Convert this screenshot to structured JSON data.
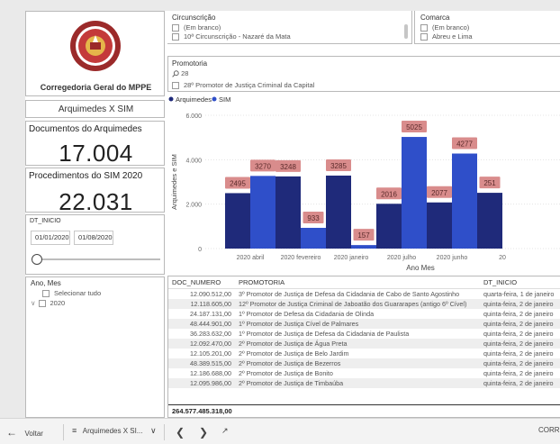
{
  "header": {
    "org_title": "Corregedoria Geral do MPPE",
    "report_title": "Arquimedes X SIM"
  },
  "kpis": {
    "docs_label": "Documentos do Arquimedes",
    "docs_value": "17.004",
    "proc_label": "Procedimentos do SIM 2020",
    "proc_value": "22.031"
  },
  "date_filter": {
    "label": "DT_INICIO",
    "start": "01/01/2020",
    "end": "01/08/2020",
    "slider_position": 0.0
  },
  "ano_mes": {
    "label": "Ano, Mes",
    "select_all": "Selecionar tudo",
    "year": "2020"
  },
  "circunscricao": {
    "label": "Circunscrição",
    "items": [
      "(Em branco)",
      "10ª Circunscrição - Nazaré da Mata"
    ]
  },
  "comarca": {
    "label": "Comarca",
    "items": [
      "(Em branco)",
      "Abreu e Lima"
    ]
  },
  "promotoria": {
    "label": "Promotoria",
    "search_value": "28",
    "item": "28º Promotor de Justiça Criminal da Capital"
  },
  "colors": {
    "arquimedes": "#1f2a7a",
    "sim": "#2f4fc9",
    "data_label_bg": "#d98c8c",
    "kpi_border": "#b0b0b0"
  },
  "chart_data": {
    "type": "bar",
    "legend": [
      "Arquimedes",
      "SIM"
    ],
    "legend_position": "top-left",
    "xlabel": "Ano Mes",
    "ylabel": "Arquimedes e SIM",
    "ylim": [
      0,
      6000
    ],
    "yticks": [
      "0",
      "2.000",
      "4.000",
      "6.000"
    ],
    "categories": [
      "2020 abril",
      "2020 fevereiro",
      "2020 janeiro",
      "2020 julho",
      "2020 junho",
      "20"
    ],
    "series": [
      {
        "name": "Arquimedes",
        "values": [
          2495,
          3248,
          3285,
          2016,
          2077,
          2510
        ],
        "labels": [
          "2495",
          "3248",
          "3285",
          "2016",
          "2077",
          "251"
        ]
      },
      {
        "name": "SIM",
        "values": [
          3270,
          933,
          157,
          5025,
          4277,
          null
        ],
        "labels": [
          "3270",
          "933",
          "157",
          "5025",
          "4277",
          ""
        ]
      }
    ],
    "grid": true
  },
  "table": {
    "columns": [
      "DOC_NUMERO",
      "PROMOTORIA",
      "DT_INICIO"
    ],
    "rows": [
      [
        "12.090.512,00",
        "3º Promotor de Justiça de Defesa da Cidadania de Cabo de Santo Agostinho",
        "quarta-feira, 1 de janeiro"
      ],
      [
        "12.118.605,00",
        "12º Promotor de Justiça Criminal de Jaboatão dos Guararapes (antigo 6º Cível)",
        "quinta-feira, 2 de janeiro"
      ],
      [
        "24.187.131,00",
        "1º Promotor de Defesa da Cidadania de Olinda",
        "quinta-feira, 2 de janeiro"
      ],
      [
        "48.444.901,00",
        "1º Promotor de Justiça Cível de Palmares",
        "quinta-feira, 2 de janeiro"
      ],
      [
        "36.283.632,00",
        "1º Promotor de Justiça de Defesa da Cidadania de Paulista",
        "quinta-feira, 2 de janeiro"
      ],
      [
        "12.092.470,00",
        "2º Promotor de Justiça de Água Preta",
        "quinta-feira, 2 de janeiro"
      ],
      [
        "12.105.201,00",
        "2º Promotor de Justiça de Belo Jardim",
        "quinta-feira, 2 de janeiro"
      ],
      [
        "48.389.515,00",
        "2º Promotor de Justiça de Bezerros",
        "quinta-feira, 2 de janeiro"
      ],
      [
        "12.186.688,00",
        "2º Promotor de Justiça de Bonito",
        "quinta-feira, 2 de janeiro"
      ],
      [
        "12.095.986,00",
        "2º Promotor de Justiça de Timbaúba",
        "quinta-feira, 2 de janeiro"
      ]
    ],
    "total": "264.577.485.318,00"
  },
  "bottombar": {
    "back_label": "Voltar",
    "page_label": "Arquimedes X SI...",
    "right_label": "CORR"
  }
}
